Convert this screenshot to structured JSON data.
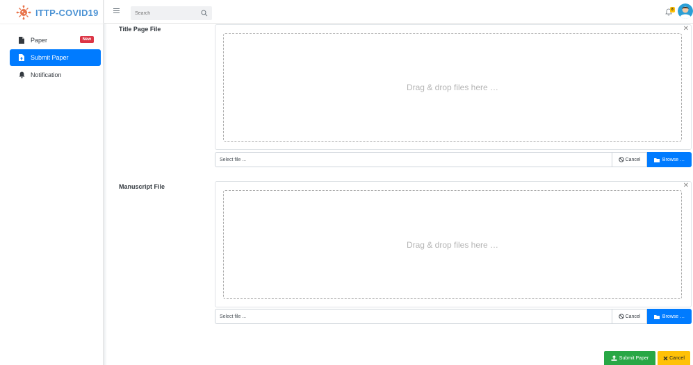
{
  "brand": {
    "name": "ITTP-COVID19",
    "logo": "virus-logo-icon"
  },
  "sidebar": {
    "items": [
      {
        "label": "Paper",
        "icon": "file-icon",
        "badge": "New"
      },
      {
        "label": "Submit Paper",
        "icon": "file-upload-icon",
        "active": true
      },
      {
        "label": "Notification",
        "icon": "bell-icon"
      }
    ]
  },
  "header": {
    "search": {
      "placeholder": "Search"
    },
    "notification_count": "8"
  },
  "form": {
    "title_page": {
      "label": "Title Page File",
      "drop_text": "Drag & drop files here …",
      "caption_placeholder": "Select file ...",
      "cancel_label": "Cancel",
      "browse_label": "Browse …"
    },
    "manuscript": {
      "label": "Manuscript File",
      "drop_text": "Drag & drop files here …",
      "caption_placeholder": "Select file ...",
      "cancel_label": "Cancel",
      "browse_label": "Browse …"
    },
    "submit_label": "Submit Paper",
    "cancel_label": "Cancel"
  },
  "colors": {
    "primary": "#007bff",
    "success": "#28a745",
    "warning": "#ffc107",
    "danger": "#dc3545",
    "brand": "#4c93d4"
  }
}
